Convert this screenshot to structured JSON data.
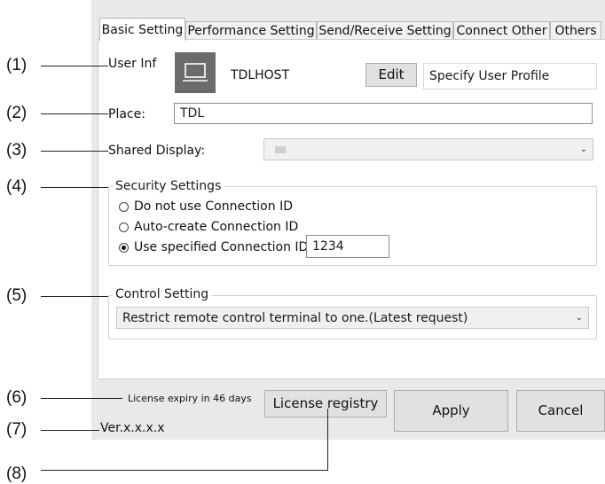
{
  "tabs": [
    "Basic Setting",
    "Performance Setting",
    "Send/Receive Setting",
    "Connect Other",
    "Others"
  ],
  "user_info": {
    "label": "User Inf",
    "host_name": "TDLHOST",
    "edit_label": "Edit",
    "profile_label": "Specify User Profile",
    "icon": "computer-icon"
  },
  "place": {
    "label": "Place:",
    "value": "TDL"
  },
  "shared_display": {
    "label": "Shared Display:",
    "value": ""
  },
  "security": {
    "title": "Security Settings",
    "options": [
      "Do not use Connection ID",
      "Auto-create Connection ID",
      "Use specified Connection ID"
    ],
    "selected_index": 2,
    "connection_id": "1234"
  },
  "control": {
    "title": "Control Setting",
    "value": "Restrict remote control terminal to one.(Latest request)"
  },
  "license": {
    "expiry": "License expiry in 46 days",
    "registry_label": "License registry"
  },
  "apply_label": "Apply",
  "cancel_label": "Cancel",
  "version": "Ver.x.x.x.x",
  "callouts": [
    "(1)",
    "(2)",
    "(3)",
    "(4)",
    "(5)",
    "(6)",
    "(7)",
    "(8)"
  ]
}
